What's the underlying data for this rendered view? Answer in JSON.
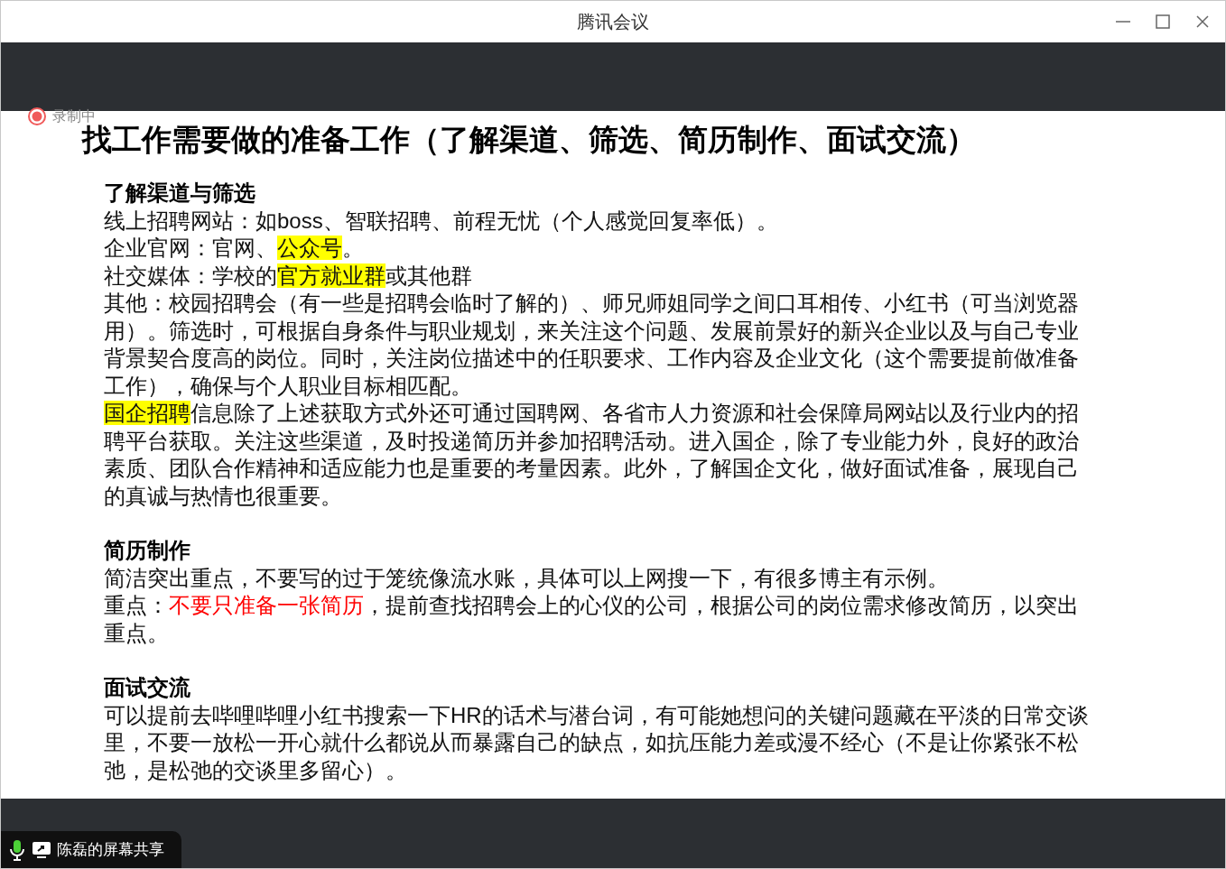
{
  "window": {
    "title": "腾讯会议"
  },
  "recording": {
    "label": "录制中"
  },
  "document": {
    "title": "找工作需要做的准备工作（了解渠道、筛选、简历制作、面试交流）",
    "sections": [
      {
        "heading": "了解渠道与筛选",
        "paragraphs": [
          [
            {
              "kind": "plain",
              "text": "线上招聘网站：如boss、智联招聘、前程无忧（个人感觉回复率低）。"
            }
          ],
          [
            {
              "kind": "plain",
              "text": "企业官网：官网、"
            },
            {
              "kind": "highlight",
              "text": "公众号"
            },
            {
              "kind": "plain",
              "text": "。"
            }
          ],
          [
            {
              "kind": "plain",
              "text": "社交媒体：学校的"
            },
            {
              "kind": "highlight",
              "text": "官方就业群"
            },
            {
              "kind": "plain",
              "text": "或其他群"
            }
          ],
          [
            {
              "kind": "plain",
              "text": "其他：校园招聘会（有一些是招聘会临时了解的）、师兄师姐同学之间口耳相传、小红书（可当浏览器用）。筛选时，可根据自身条件与职业规划，来关注这个问题、发展前景好的新兴企业以及与自己专业背景契合度高的岗位。同时，关注岗位描述中的任职要求、工作内容及企业文化（这个需要提前做准备工作），确保与个人职业目标相匹配。"
            }
          ],
          [
            {
              "kind": "highlight",
              "text": "国企招聘"
            },
            {
              "kind": "plain",
              "text": "信息除了上述获取方式外还可通过国聘网、各省市人力资源和社会保障局网站以及行业内的招聘平台获取。关注这些渠道，及时投递简历并参加招聘活动。进入国企，除了专业能力外，良好的政治素质、团队合作精神和适应能力也是重要的考量因素。此外，了解国企文化，做好面试准备，展现自己的真诚与热情也很重要。"
            }
          ]
        ]
      },
      {
        "heading": "简历制作",
        "paragraphs": [
          [
            {
              "kind": "plain",
              "text": "简洁突出重点，不要写的过于笼统像流水账，具体可以上网搜一下，有很多博主有示例。"
            }
          ],
          [
            {
              "kind": "plain",
              "text": "重点："
            },
            {
              "kind": "red",
              "text": "不要只准备一张简历"
            },
            {
              "kind": "plain",
              "text": "，提前查找招聘会上的心仪的公司，根据公司的岗位需求修改简历，以突出重点。"
            }
          ]
        ]
      },
      {
        "heading": "面试交流",
        "paragraphs": [
          [
            {
              "kind": "plain",
              "text": "可以提前去哔哩哔哩小红书搜索一下HR的话术与潜台词，有可能她想问的关键问题藏在平淡的日常交谈里，不要一放松一开心就什么都说从而暴露自己的缺点，如抗压能力差或漫不经心（不是让你紧张不松弛，是松弛的交谈里多留心）。"
            }
          ]
        ]
      }
    ]
  },
  "share_indicator": {
    "label": "陈磊的屏幕共享"
  }
}
